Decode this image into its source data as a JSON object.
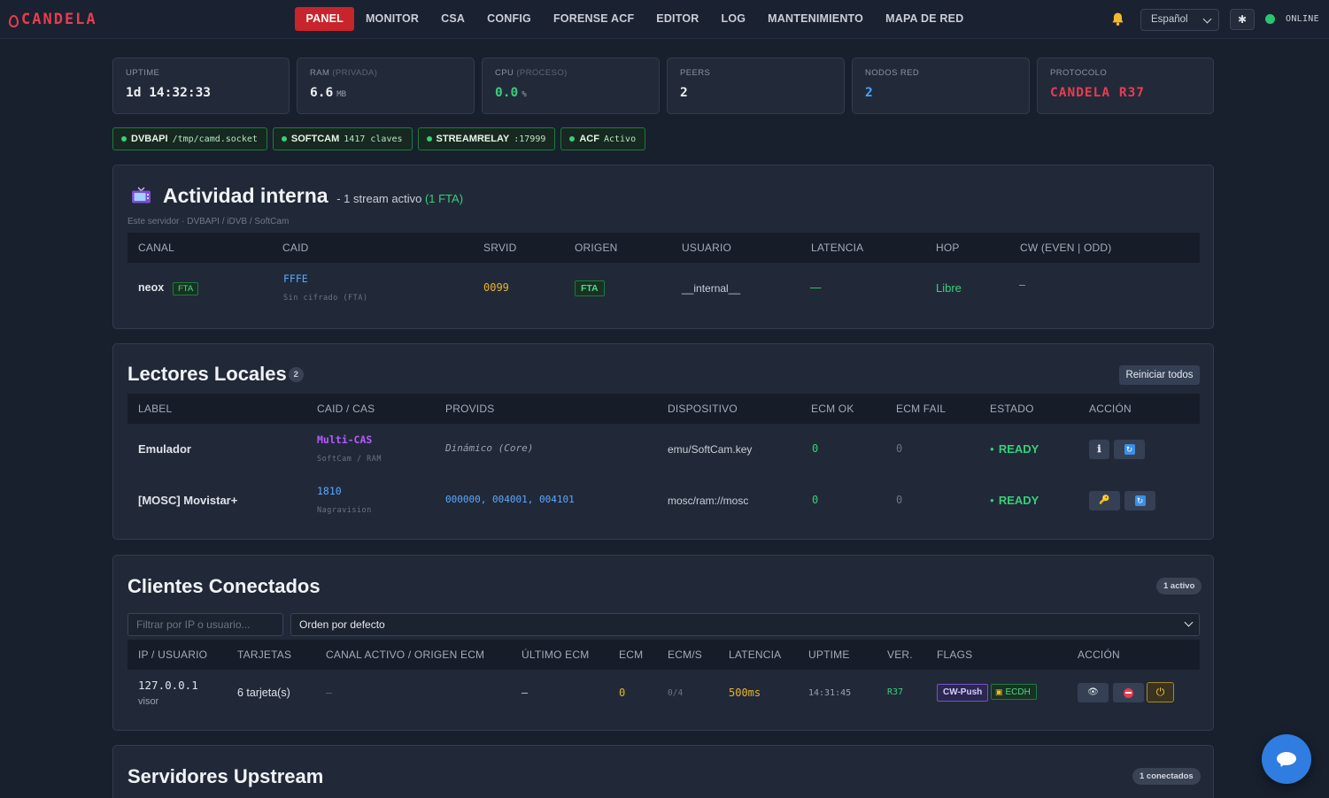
{
  "nav": {
    "brand": "CANDELA",
    "items": [
      "PANEL",
      "MONITOR",
      "CSA",
      "CONFIG",
      "FORENSE ACF",
      "EDITOR",
      "LOG",
      "MANTENIMIENTO",
      "MAPA DE RED"
    ],
    "language": "Español",
    "theme_icon": "✱",
    "status": "ONLINE"
  },
  "stats": [
    {
      "label": "UPTIME",
      "label_dim": "",
      "value": "1d 14:32:33",
      "unit": ""
    },
    {
      "label": "RAM ",
      "label_dim": "(PRIVADA)",
      "value": "6.6",
      "unit": "MB"
    },
    {
      "label": "CPU ",
      "label_dim": "(PROCESO)",
      "value": "0.0",
      "unit": "%"
    },
    {
      "label": "PEERS",
      "label_dim": "",
      "value": "2",
      "unit": ""
    },
    {
      "label": "NODOS RED",
      "label_dim": "",
      "value": "2",
      "unit": ""
    },
    {
      "label": "PROTOCOLO",
      "label_dim": "",
      "value": "CANDELA R37",
      "unit": ""
    }
  ],
  "pills": [
    {
      "name": "DVBAPI",
      "value": "/tmp/camd.socket"
    },
    {
      "name": "SOFTCAM",
      "value": "1417 claves"
    },
    {
      "name": "STREAMRELAY",
      "value": ":17999"
    },
    {
      "name": "ACF",
      "value": "Activo"
    }
  ],
  "activity": {
    "title": "Actividad interna",
    "subtitle_prefix": "- 1 stream activo ",
    "subtitle_highlight": "(1 FTA)",
    "caption": "Este servidor · DVBAPI / iDVB / SoftCam",
    "columns": [
      "CANAL",
      "CAID",
      "SRVID",
      "ORIGEN",
      "USUARIO",
      "LATENCIA",
      "HOP",
      "CW (EVEN | ODD)"
    ],
    "row": {
      "channel": "neox",
      "channel_tag": "FTA",
      "caid": "FFFE",
      "caid_sub": "Sin cifrado (FTA)",
      "srvid": "0099",
      "origin": "FTA",
      "user": "__internal__",
      "latency": "—",
      "hop": "Libre",
      "cw": "–"
    }
  },
  "readers": {
    "title": "Lectores Locales",
    "count": "2",
    "restart_all": "Reiniciar todos",
    "columns": [
      "LABEL",
      "CAID / CAS",
      "PROVIDS",
      "DISPOSITIVO",
      "ECM OK",
      "ECM FAIL",
      "ESTADO",
      "ACCIÓN"
    ],
    "rows": [
      {
        "label": "Emulador",
        "caid": "Multi-CAS",
        "caid_sub": "SoftCam / RAM",
        "provids": "Dinámico (Core)",
        "device": "emu/SoftCam.key",
        "ecm_ok": "0",
        "ecm_fail": "0",
        "state": "READY",
        "action1": "ℹ",
        "action2": "↻"
      },
      {
        "label": "[MOSC] Movistar+",
        "caid": "1810",
        "caid_sub": "Nagravision",
        "provids": "000000, 004001, 004101",
        "device": "mosc/ram://mosc",
        "ecm_ok": "0",
        "ecm_fail": "0",
        "state": "READY",
        "action1": "🔑",
        "action2": "↻"
      }
    ],
    "colors": {
      "multi_cas": "#b45cff",
      "caid_blue": "#5aa8ff"
    }
  },
  "clients": {
    "title": "Clientes Conectados",
    "badge": "1 activo",
    "filter_placeholder": "Filtrar por IP o usuario...",
    "order": "Orden por defecto",
    "columns": [
      "IP / USUARIO",
      "TARJETAS",
      "CANAL ACTIVO / ORIGEN ECM",
      "ÚLTIMO ECM",
      "ECM",
      "ECM/S",
      "LATENCIA",
      "UPTIME",
      "VER.",
      "FLAGS",
      "ACCIÓN"
    ],
    "row": {
      "ip": "127.0.0.1",
      "user": "visor",
      "cards": "6 tarjeta(s)",
      "channel": "–",
      "last_ecm": "–",
      "ecm": "0",
      "ecm_s": "0/4",
      "latency": "500ms",
      "uptime": "14:31:45",
      "version": "R37",
      "flag1": "CW-Push",
      "flag2": "ECDH",
      "action_view": "👁"
    }
  },
  "upstream": {
    "title": "Servidores Upstream",
    "badge": "1 conectados"
  }
}
